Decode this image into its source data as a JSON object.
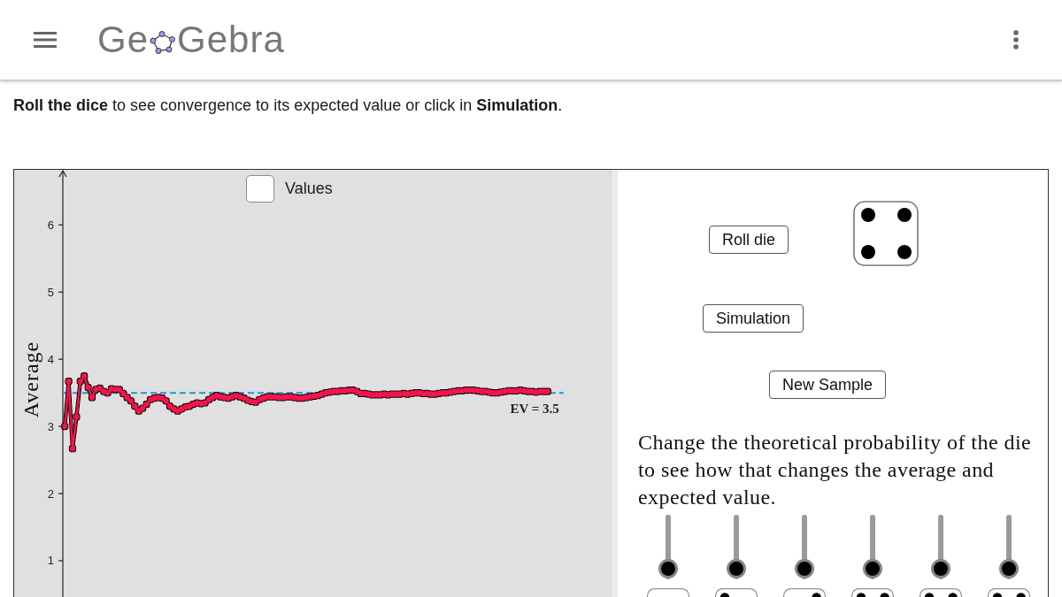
{
  "header": {
    "logo": {
      "before": "Ge",
      "after": "Gebra"
    }
  },
  "instructions": "**Roll the dice** to see convergence to its expected value or click in **Simulation**.",
  "graphics": {
    "values_checkbox": {
      "label": "Values",
      "checked": false
    },
    "chart_data": {
      "type": "line",
      "ylabel": "Average",
      "categories": [
        null,
        null,
        null,
        null,
        null,
        null,
        null,
        null,
        null,
        null,
        null,
        null,
        null,
        null,
        null,
        null,
        null,
        null,
        null,
        null,
        null,
        null,
        null,
        null,
        null,
        null,
        null,
        null,
        null,
        null,
        null,
        null,
        null,
        null,
        null,
        null,
        null,
        null,
        null,
        null,
        null,
        null,
        null,
        null,
        null,
        null,
        null,
        null,
        null,
        null,
        null,
        null,
        null,
        null,
        null,
        null,
        null,
        null,
        null,
        null,
        null,
        null,
        null,
        null,
        null,
        null,
        null,
        null,
        null,
        null,
        null,
        null,
        null,
        null,
        null,
        null,
        null,
        null,
        null,
        null,
        null,
        null,
        null,
        null,
        null,
        null,
        null,
        null,
        null,
        null,
        null,
        null,
        null,
        null,
        null,
        null,
        null,
        null,
        null,
        null,
        null,
        null,
        null,
        null,
        null,
        null,
        null,
        null,
        null,
        null,
        null,
        null,
        null,
        null,
        null,
        null,
        null,
        null,
        null,
        null,
        null,
        null,
        null,
        null,
        null
      ],
      "series": [
        {
          "color": "#f0144b",
          "marker": "circle",
          "values": [
            3.0,
            3.67,
            2.67,
            3.14,
            3.67,
            3.75,
            3.58,
            3.43,
            3.55,
            3.57,
            3.52,
            3.5,
            3.56,
            3.55,
            3.55,
            3.49,
            3.43,
            3.38,
            3.3,
            3.23,
            3.27,
            3.33,
            3.4,
            3.42,
            3.43,
            3.42,
            3.38,
            3.3,
            3.26,
            3.23,
            3.26,
            3.29,
            3.3,
            3.33,
            3.35,
            3.34,
            3.35,
            3.4,
            3.43,
            3.46,
            3.44,
            3.43,
            3.42,
            3.44,
            3.46,
            3.44,
            3.42,
            3.39,
            3.37,
            3.36,
            3.4,
            3.42,
            3.44,
            3.44,
            3.44,
            3.43,
            3.43,
            3.44,
            3.44,
            3.43,
            3.42,
            3.42,
            3.43,
            3.44,
            3.45,
            3.46,
            3.48,
            3.5,
            3.51,
            3.52,
            3.52,
            3.53,
            3.53,
            3.54,
            3.54,
            3.52,
            3.49,
            3.49,
            3.48,
            3.47,
            3.47,
            3.47,
            3.48,
            3.47,
            3.48,
            3.48,
            3.48,
            3.49,
            3.48,
            3.49,
            3.5,
            3.5,
            3.49,
            3.49,
            3.48,
            3.48,
            3.49,
            3.5,
            3.5,
            3.51,
            3.52,
            3.53,
            3.53,
            3.54,
            3.54,
            3.54,
            3.53,
            3.52,
            3.52,
            3.51,
            3.5,
            3.5,
            3.51,
            3.52,
            3.53,
            3.53,
            3.53,
            3.54,
            3.53,
            3.52,
            3.52,
            3.51,
            3.52,
            3.52,
            3.52
          ]
        }
      ],
      "ylim": [
        0.46,
        6.82
      ],
      "yticks": [
        1,
        2,
        3,
        4,
        5,
        6
      ],
      "ref_lines": [
        {
          "axis": "y",
          "value": 3.5,
          "label": "EV = 3.5",
          "color": "#1a98d5"
        }
      ]
    }
  },
  "controls": {
    "buttons": [
      {
        "label": "Roll die"
      },
      {
        "label": "Simulation"
      },
      {
        "label": "New Sample"
      }
    ],
    "description": "Change the theoretical probability of the die to see how that changes the average and expected value.",
    "sliders": [
      {
        "level": 0.17
      },
      {
        "level": 0.17
      },
      {
        "level": 0.17
      },
      {
        "level": 0.17
      },
      {
        "level": 0.17
      },
      {
        "level": 0.17
      }
    ]
  }
}
